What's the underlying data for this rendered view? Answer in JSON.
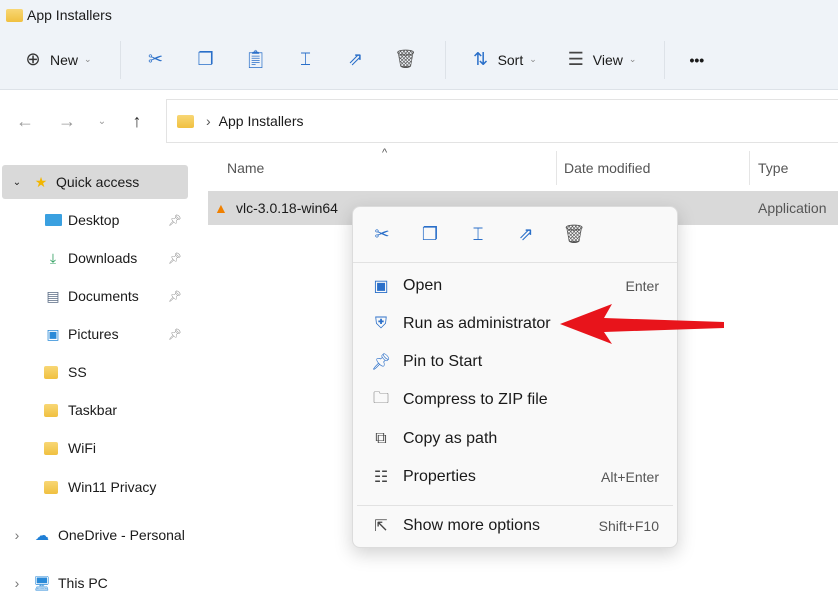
{
  "window": {
    "title": "App Installers"
  },
  "toolbar": {
    "new_label": "New",
    "sort_label": "Sort",
    "view_label": "View",
    "more": "•••"
  },
  "address": {
    "path": "App Installers",
    "sep": "›"
  },
  "sidebar": {
    "items": [
      {
        "label": "Quick access",
        "icon": "star-icon"
      },
      {
        "label": "Desktop",
        "icon": "desktop-icon",
        "pinned": true
      },
      {
        "label": "Downloads",
        "icon": "download-icon",
        "pinned": true
      },
      {
        "label": "Documents",
        "icon": "document-icon",
        "pinned": true
      },
      {
        "label": "Pictures",
        "icon": "pictures-icon",
        "pinned": true
      },
      {
        "label": "SS",
        "icon": "folder-icon"
      },
      {
        "label": "Taskbar",
        "icon": "folder-icon"
      },
      {
        "label": "WiFi",
        "icon": "folder-icon"
      },
      {
        "label": "Win11 Privacy",
        "icon": "folder-icon"
      },
      {
        "label": "OneDrive - Personal",
        "icon": "cloud-icon"
      },
      {
        "label": "This PC",
        "icon": "pc-icon"
      }
    ]
  },
  "columns": {
    "name": "Name",
    "date": "Date modified",
    "type": "Type"
  },
  "file": {
    "name": "vlc-3.0.18-win64",
    "type": "Application"
  },
  "context_menu": {
    "items": [
      {
        "label": "Open",
        "shortcut": "Enter"
      },
      {
        "label": "Run as administrator",
        "shortcut": ""
      },
      {
        "label": "Pin to Start",
        "shortcut": ""
      },
      {
        "label": "Compress to ZIP file",
        "shortcut": ""
      },
      {
        "label": "Copy as path",
        "shortcut": ""
      },
      {
        "label": "Properties",
        "shortcut": "Alt+Enter"
      },
      {
        "label": "Show more options",
        "shortcut": "Shift+F10"
      }
    ]
  },
  "colors": {
    "accent": "#2a6fc9",
    "arrow": "#e8141b",
    "selection": "#d9d9d9"
  }
}
